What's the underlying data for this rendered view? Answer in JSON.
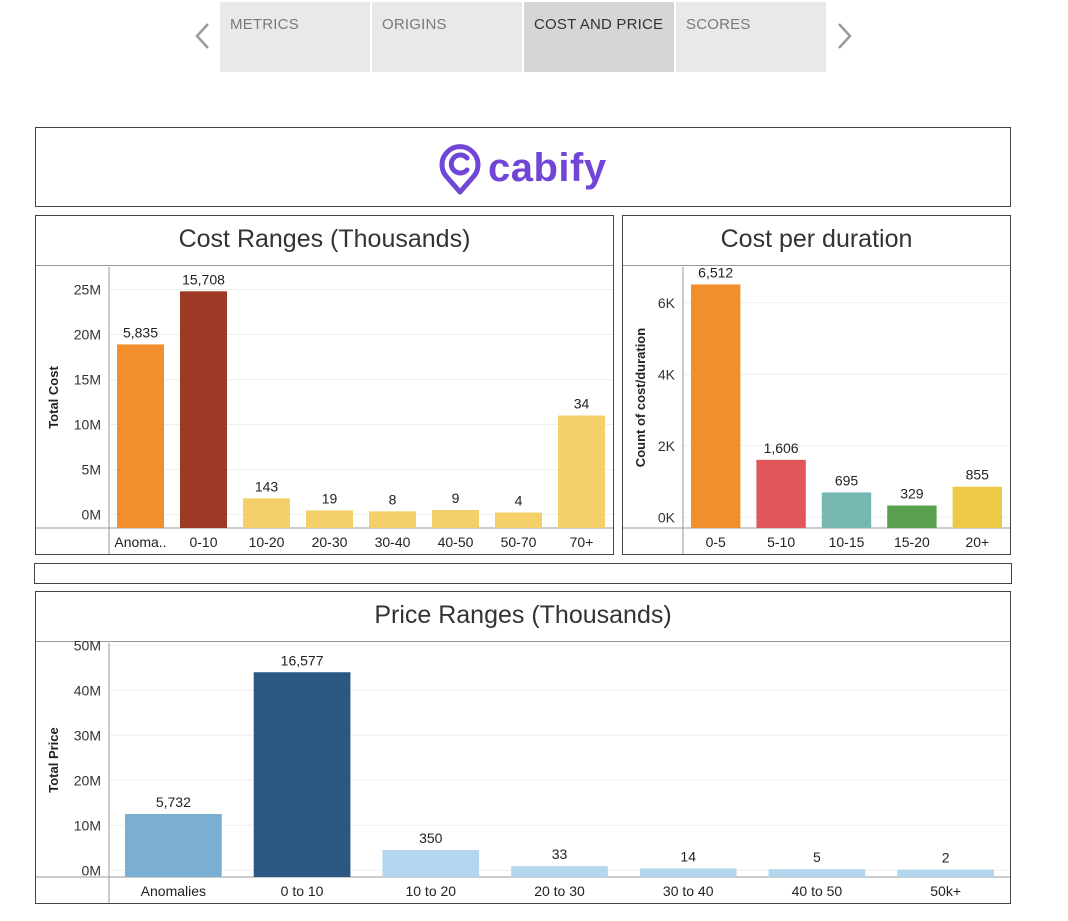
{
  "nav": {
    "tabs": [
      {
        "label": "METRICS",
        "active": false
      },
      {
        "label": "ORIGINS",
        "active": false
      },
      {
        "label": "COST AND PRICE",
        "active": true
      },
      {
        "label": "SCORES",
        "active": false
      }
    ]
  },
  "logo": {
    "text": "cabify",
    "color": "#7145d6"
  },
  "chart_data": [
    {
      "type": "bar",
      "title": "Cost Ranges (Thousands)",
      "ylabel": "Total Cost",
      "xlabel": "",
      "categories": [
        "Anoma..",
        "0-10",
        "10-20",
        "20-30",
        "30-40",
        "40-50",
        "50-70",
        "70+"
      ],
      "values": [
        18900000,
        24800000,
        1800000,
        450000,
        350000,
        500000,
        220000,
        11000000
      ],
      "data_labels": [
        "5,835",
        "15,708",
        "143",
        "19",
        "8",
        "9",
        "4",
        "34"
      ],
      "colors": [
        "#f28e2b",
        "#9c3a26",
        "#f4cf6a",
        "#f4cf6a",
        "#f4cf6a",
        "#f4cf6a",
        "#f4cf6a",
        "#f4cf6a"
      ],
      "ylim": [
        -1500000,
        27500000
      ],
      "yticks": [
        0,
        5000000,
        10000000,
        15000000,
        20000000,
        25000000
      ],
      "ytick_labels": [
        "0M",
        "5M",
        "10M",
        "15M",
        "20M",
        "25M"
      ],
      "grid": true
    },
    {
      "type": "bar",
      "title": "Cost per duration",
      "ylabel": "Count of cost/duration",
      "xlabel": "",
      "categories": [
        "0-5",
        "5-10",
        "10-15",
        "15-20",
        "20+"
      ],
      "values": [
        6512,
        1606,
        695,
        329,
        855
      ],
      "data_labels": [
        "6,512",
        "1,606",
        "695",
        "329",
        "855"
      ],
      "colors": [
        "#f28e2b",
        "#e15759",
        "#76b7b2",
        "#59a14f",
        "#edc948"
      ],
      "ylim": [
        -300,
        7000
      ],
      "yticks": [
        0,
        2000,
        4000,
        6000
      ],
      "ytick_labels": [
        "0K",
        "2K",
        "4K",
        "6K"
      ],
      "grid": true
    },
    {
      "type": "bar",
      "title": "Price Ranges (Thousands)",
      "ylabel": "Total Price",
      "xlabel": "",
      "categories": [
        "Anomalies",
        "0 to 10",
        "10 to 20",
        "20 to 30",
        "30 to 40",
        "40 to 50",
        "50k+"
      ],
      "values": [
        12500000,
        44000000,
        4500000,
        900000,
        400000,
        250000,
        150000
      ],
      "data_labels": [
        "5,732",
        "16,577",
        "350",
        "33",
        "14",
        "5",
        "2"
      ],
      "colors": [
        "#7aaed3",
        "#2b5783",
        "#b3d7ee",
        "#b3d7ee",
        "#b3d7ee",
        "#b3d7ee",
        "#b3d7ee"
      ],
      "ylim": [
        -1500000,
        50500000
      ],
      "yticks": [
        0,
        10000000,
        20000000,
        30000000,
        40000000,
        50000000
      ],
      "ytick_labels": [
        "0M",
        "10M",
        "20M",
        "30M",
        "40M",
        "50M"
      ],
      "grid": true
    }
  ]
}
